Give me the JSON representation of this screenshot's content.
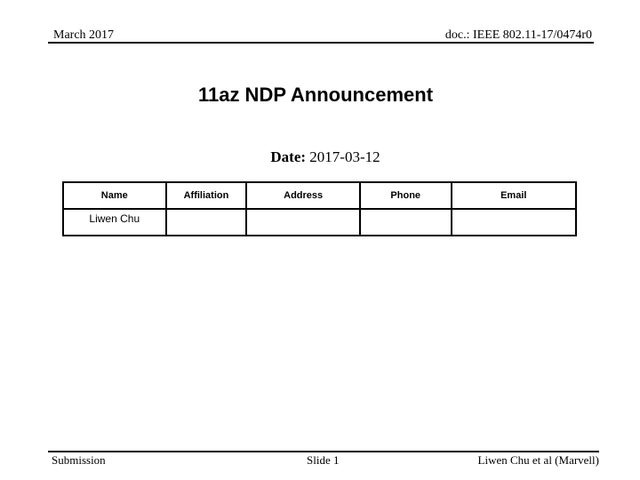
{
  "header": {
    "date": "March 2017",
    "doc_id": "doc.: IEEE 802.11-17/0474r0"
  },
  "title": "11az NDP Announcement",
  "date_line": {
    "label": "Date:",
    "value": "2017-03-12"
  },
  "authors_table": {
    "columns": [
      "Name",
      "Affiliation",
      "Address",
      "Phone",
      "Email"
    ],
    "rows": [
      [
        "Liwen Chu",
        "",
        "",
        "",
        ""
      ]
    ]
  },
  "footer": {
    "left": "Submission",
    "center": "Slide 1",
    "right": "Liwen Chu et al (Marvell)"
  }
}
